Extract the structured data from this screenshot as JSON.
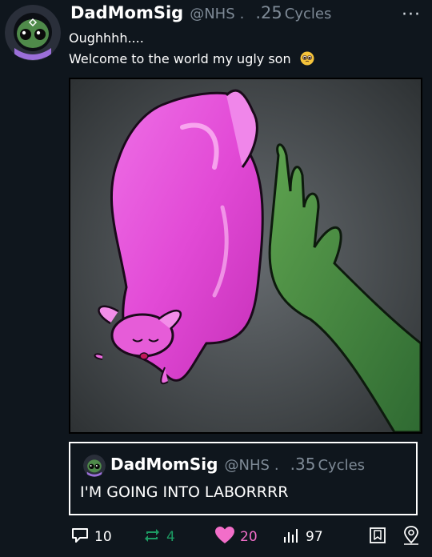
{
  "post": {
    "author": {
      "display_name": "DadMomSig",
      "handle": "@NHS",
      "separator": ".",
      "age_value": ".25",
      "age_unit": "Cycles"
    },
    "text_lines": [
      "Oughhhh....",
      "Welcome to the world my ugly son"
    ],
    "more_icon": "ellipsis-horizontal-icon",
    "media": {
      "subject": "pink-creature-and-green-hand-illustration"
    }
  },
  "quoted_post": {
    "author": {
      "display_name": "DadMomSig",
      "handle": "@NHS",
      "separator": ".",
      "age_value": ".35",
      "age_unit": "Cycles"
    },
    "text": "I'M GOING INTO LABORRRR"
  },
  "actions": {
    "reply": {
      "icon": "reply-icon",
      "count": "10",
      "color": "#ffffff"
    },
    "repost": {
      "icon": "repost-icon",
      "count": "4",
      "color": "#1d9b63"
    },
    "like": {
      "icon": "heart-icon",
      "count": "20",
      "color": "#f26ec9"
    },
    "views": {
      "icon": "views-bar-icon",
      "count": "97",
      "color": "#ffffff"
    },
    "bookmark": {
      "icon": "bookmark-icon"
    },
    "share": {
      "icon": "share-icon"
    }
  },
  "colors": {
    "background": "#0f161d",
    "muted_text": "#7e8a96",
    "repost_green": "#1d9b63",
    "like_pink": "#f26ec9",
    "avatar_ring": "#3a4150",
    "avatar_scarf": "#9b6fd9"
  }
}
